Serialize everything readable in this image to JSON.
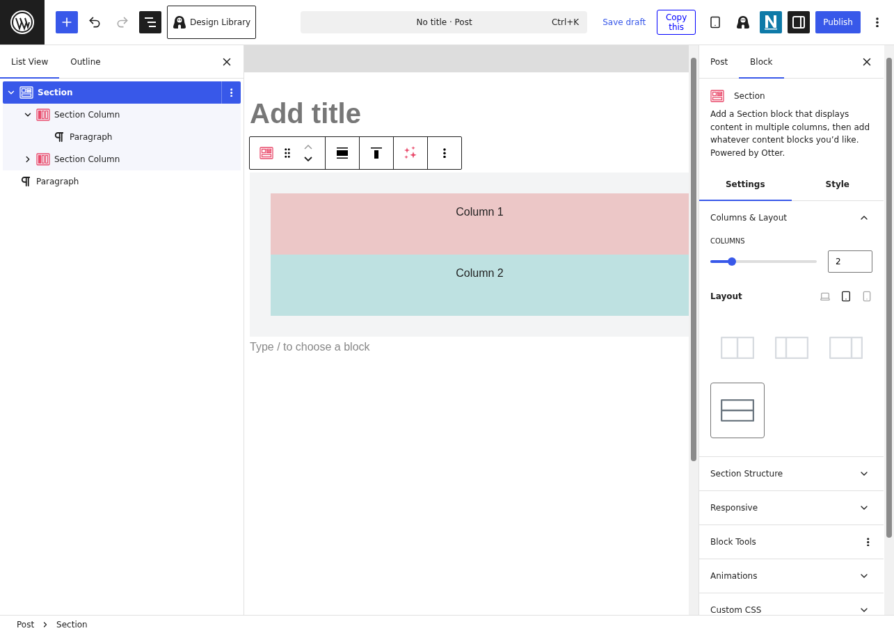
{
  "topbar": {
    "design_library": "Design Library",
    "command": {
      "title": "No title · Post",
      "shortcut": "Ctrl+K"
    },
    "save_draft": "Save draft",
    "copy": "Copy this",
    "publish": "Publish"
  },
  "left_panel": {
    "tabs": [
      {
        "label": "List View",
        "selected": true
      },
      {
        "label": "Outline",
        "selected": false
      }
    ],
    "tree": [
      {
        "kind": "section",
        "label": "Section",
        "selected": true,
        "expanded": true,
        "children": [
          {
            "kind": "column",
            "label": "Section Column",
            "selected": false,
            "expanded": true,
            "children": [
              {
                "kind": "paragraph",
                "label": "Paragraph",
                "selected": false
              }
            ]
          },
          {
            "kind": "column",
            "label": "Section Column",
            "selected": false,
            "expanded": false
          }
        ]
      },
      {
        "kind": "paragraph",
        "label": "Paragraph",
        "selected": false
      }
    ]
  },
  "editor": {
    "title_placeholder": "Add title",
    "columns": [
      {
        "label": "Column 1",
        "color": "#ecc7c7"
      },
      {
        "label": "Column 2",
        "color": "#bee1e1"
      }
    ],
    "appender_placeholder": "Type / to choose a block"
  },
  "right_panel": {
    "tabs": [
      {
        "label": "Post",
        "selected": false
      },
      {
        "label": "Block",
        "selected": true
      }
    ],
    "block": {
      "name": "Section",
      "description": "Add a Section block that displays content in multiple columns, then add whatever content blocks you’d like. Powered by Otter."
    },
    "subtabs": [
      {
        "label": "Settings",
        "selected": true
      },
      {
        "label": "Style",
        "selected": false
      }
    ],
    "columns_layout": {
      "title": "Columns & Layout",
      "expanded": true,
      "columns_label": "COLUMNS",
      "level": 0.2,
      "value": "2",
      "layout_label": "Layout",
      "devices": [
        {
          "kind": "desktop",
          "selected": false
        },
        {
          "kind": "tablet",
          "selected": true
        },
        {
          "kind": "mobile",
          "selected": false
        }
      ],
      "options": [
        {
          "kind": "equal",
          "selected": false
        },
        {
          "kind": "narrow-left",
          "selected": false
        },
        {
          "kind": "narrow-right",
          "selected": false
        },
        {
          "kind": "stacked",
          "selected": true
        }
      ]
    },
    "sections": [
      {
        "title": "Section Structure",
        "kind": "collapse"
      },
      {
        "title": "Responsive",
        "kind": "collapse"
      },
      {
        "title": "Block Tools",
        "kind": "menu"
      },
      {
        "title": "Animations",
        "kind": "collapse"
      },
      {
        "title": "Custom CSS",
        "kind": "collapse"
      }
    ]
  },
  "breadcrumb": [
    "Post",
    "Section"
  ]
}
